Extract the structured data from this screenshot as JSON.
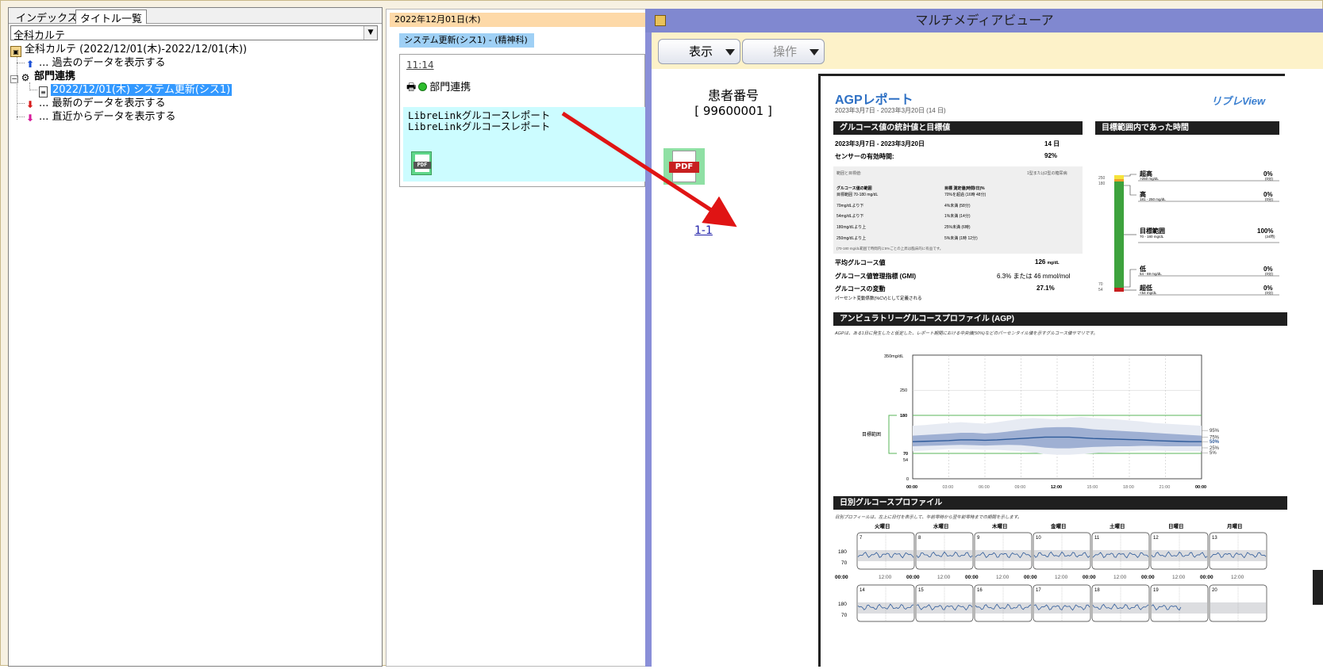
{
  "left_panel": {
    "tabs": [
      "インデックス",
      "タイトル一覧"
    ],
    "combo_value": "全科カルテ",
    "tree": {
      "root": "全科カルテ (2022/12/01(木)-2022/12/01(木))",
      "past": "... 過去のデータを表示する",
      "dept": "部門連携",
      "entry": "2022/12/01(木) システム更新(シス1)",
      "latest": "... 最新のデータを表示する",
      "recent": "... 直近からデータを表示する"
    }
  },
  "middle_panel": {
    "date_header": "2022年12月01日(木)",
    "system_bar": "システム更新(シス1) - (精神科)",
    "time": "11:14",
    "dept": "部門連携",
    "body_lines": [
      "LibreLinkグルコースレポート",
      "LibreLinkグルコースレポート"
    ],
    "pdf_label": "PDF"
  },
  "viewer": {
    "title": "マルチメディアビューア",
    "buttons": {
      "view": "表示",
      "operate": "操作"
    },
    "patient_label": "患者番号",
    "patient_number": "[ 99600001 ]",
    "pdf_label": "PDF",
    "page_link": "1-1"
  },
  "report": {
    "title": "AGPレポート",
    "brand": "リブレView",
    "date_range": "2023年3月7日 - 2023年3月20日 (14 日)",
    "section_stats": "グルコース値の統計値と目標値",
    "section_tir": "目標範囲内であった時間",
    "period": "2023年3月7日 - 2023年3月20日",
    "period_days": "14 日",
    "sensor_label": "センサーの有効時間:",
    "sensor_value": "92%",
    "ranges_caption": "範囲と目標値:",
    "ranges_type": "1型または2型の糖尿病",
    "glucose_range_head": "グルコース値の範囲",
    "target_head": "目標 測定値(時間/日)%",
    "target_range": "目標範囲 70-180 mg/dL",
    "target_range_goal": "70%を超過 (16時 48分)",
    "rows": [
      [
        "70mg/dLより下",
        "4%未満 (58分)"
      ],
      [
        "54mg/dLより下",
        "1%未満 (14分)"
      ],
      [
        "180mg/dLより上",
        "25%未満 (6時)"
      ],
      [
        "250mg/dLより上",
        "5%未満 (1時 12分)"
      ]
    ],
    "ranges_note": "(70-180 mg/dL範囲で時間内に5%ごとの上昇は臨床的に有益です。",
    "avg_label": "平均グルコース値",
    "avg_value": "126",
    "avg_unit": "mg/dL",
    "gmi_label": "グルコース値管理指標 (GMI)",
    "gmi_value": "6.3% または 46 mmol/mol",
    "cv_label": "グルコースの変動",
    "cv_value": "27.1%",
    "cv_note": "パーセント変動係数(%CV)として定義される",
    "tir_levels": [
      {
        "name": "超高",
        "range": ">250 mg/dL",
        "pct": "0%",
        "time": "(0分)"
      },
      {
        "name": "高",
        "range": "181 - 250 mg/dL",
        "pct": "0%",
        "time": "(0分)"
      },
      {
        "name": "目標範囲",
        "range": "70 - 180 mg/dL",
        "pct": "100%",
        "time": "(24時)"
      },
      {
        "name": "低",
        "range": "54 - 69 mg/dL",
        "pct": "0%",
        "time": "(0分)"
      },
      {
        "name": "超低",
        "range": "<54 mg/dL",
        "pct": "0%",
        "time": "(0分)"
      }
    ],
    "tir_ticks": [
      "250",
      "180",
      "70",
      "54"
    ],
    "agp_section": "アンビュラトリーグルコースプロファイル (AGP)",
    "agp_note": "AGPは、ある1日に発生したと仮定した、レポート期間における中央値(50%)などのパーセンタイル値を示すグルコース値サマリです。",
    "agp_y_top": "350mg/dL",
    "agp_y_ticks": [
      "250",
      "180",
      "70",
      "54",
      "0"
    ],
    "agp_target_label": "目標範囲",
    "agp_percentiles": [
      "95%",
      "75%",
      "50%",
      "25%",
      "5%"
    ],
    "agp_x_ticks": [
      "00:00",
      "03:00",
      "06:00",
      "09:00",
      "12:00",
      "15:00",
      "18:00",
      "21:00",
      "00:00"
    ],
    "daily_section": "日別グルコースプロファイル",
    "daily_note": "日別プロフィールは、左上に日付を表示して、午前零時から翌午前零時までの期間を示します。",
    "weekdays": [
      "火曜日",
      "水曜日",
      "木曜日",
      "金曜日",
      "土曜日",
      "日曜日",
      "月曜日"
    ],
    "week1_days": [
      "7",
      "8",
      "9",
      "10",
      "11",
      "12",
      "13"
    ],
    "week2_days": [
      "14",
      "15",
      "16",
      "17",
      "18",
      "19",
      "20"
    ],
    "daily_y": [
      "180",
      "70"
    ],
    "daily_x": [
      "00:00",
      "12:00"
    ]
  }
}
